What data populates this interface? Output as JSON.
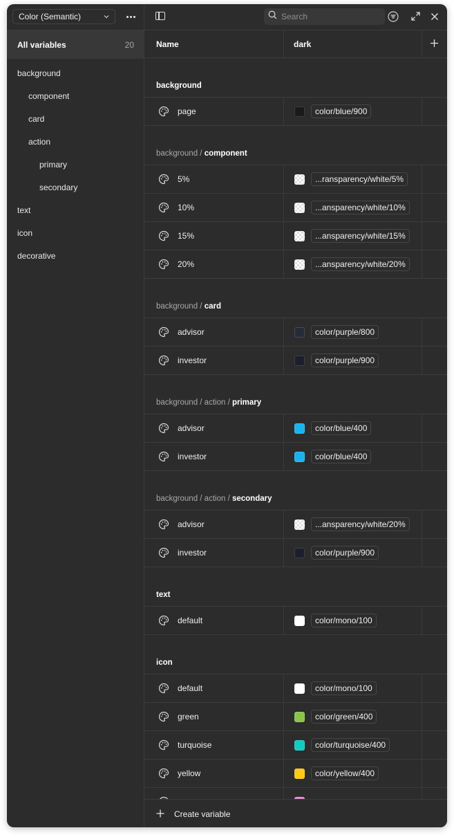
{
  "sidebar": {
    "collection": "Color (Semantic)",
    "all_variables_label": "All variables",
    "all_variables_count": "20",
    "groups": [
      {
        "label": "background",
        "indent": 0
      },
      {
        "label": "component",
        "indent": 1
      },
      {
        "label": "card",
        "indent": 1
      },
      {
        "label": "action",
        "indent": 1
      },
      {
        "label": "primary",
        "indent": 2
      },
      {
        "label": "secondary",
        "indent": 2
      },
      {
        "label": "text",
        "indent": 0
      },
      {
        "label": "icon",
        "indent": 0
      },
      {
        "label": "decorative",
        "indent": 0
      }
    ]
  },
  "toolbar": {
    "search_placeholder": "Search"
  },
  "table": {
    "col_name": "Name",
    "col_mode": "dark",
    "sections": [
      {
        "prefix": "",
        "leaf": "background",
        "rows": [
          {
            "name": "page",
            "value": "color/blue/900",
            "swatch": "#1a1a1a",
            "checker": false
          }
        ]
      },
      {
        "prefix": "background / ",
        "leaf": "component",
        "rows": [
          {
            "name": "5%",
            "value": "...ransparency/white/5%",
            "swatch": "#ffffff",
            "checker": true
          },
          {
            "name": "10%",
            "value": "...ansparency/white/10%",
            "swatch": "#ffffff",
            "checker": true
          },
          {
            "name": "15%",
            "value": "...ansparency/white/15%",
            "swatch": "#ffffff",
            "checker": true
          },
          {
            "name": "20%",
            "value": "...ansparency/white/20%",
            "swatch": "#ffffff",
            "checker": true
          }
        ]
      },
      {
        "prefix": "background / ",
        "leaf": "card",
        "rows": [
          {
            "name": "advisor",
            "value": "color/purple/800",
            "swatch": "#272a38",
            "checker": false
          },
          {
            "name": "investor",
            "value": "color/purple/900",
            "swatch": "#1c1f2b",
            "checker": false
          }
        ]
      },
      {
        "prefix": "background / action / ",
        "leaf": "primary",
        "rows": [
          {
            "name": "advisor",
            "value": "color/blue/400",
            "swatch": "#1ab3f0",
            "checker": false
          },
          {
            "name": "investor",
            "value": "color/blue/400",
            "swatch": "#1ab3f0",
            "checker": false
          }
        ]
      },
      {
        "prefix": "background / action / ",
        "leaf": "secondary",
        "rows": [
          {
            "name": "advisor",
            "value": "...ansparency/white/20%",
            "swatch": "#ffffff",
            "checker": true
          },
          {
            "name": "investor",
            "value": "color/purple/900",
            "swatch": "#1c1f2b",
            "checker": false
          }
        ]
      },
      {
        "prefix": "",
        "leaf": "text",
        "rows": [
          {
            "name": "default",
            "value": "color/mono/100",
            "swatch": "#ffffff",
            "checker": false
          }
        ]
      },
      {
        "prefix": "",
        "leaf": "icon",
        "rows": [
          {
            "name": "default",
            "value": "color/mono/100",
            "swatch": "#ffffff",
            "checker": false
          },
          {
            "name": "green",
            "value": "color/green/400",
            "swatch": "#8bc34a",
            "checker": false
          },
          {
            "name": "turquoise",
            "value": "color/turquoise/400",
            "swatch": "#14c9c0",
            "checker": false
          },
          {
            "name": "yellow",
            "value": "color/yellow/400",
            "swatch": "#ffc814",
            "checker": false
          },
          {
            "name": "",
            "value": "",
            "swatch": "#e58ad3",
            "checker": false
          }
        ]
      }
    ]
  },
  "footer": {
    "create_label": "Create variable"
  },
  "icons": {
    "chevron": "chevron-down-icon",
    "more": "more-icon",
    "sidebar_toggle": "sidebar-toggle-icon",
    "search": "search-icon",
    "filter": "filter-icon",
    "expand": "expand-icon",
    "close": "close-icon",
    "add_column": "plus-icon",
    "variable": "palette-icon"
  }
}
